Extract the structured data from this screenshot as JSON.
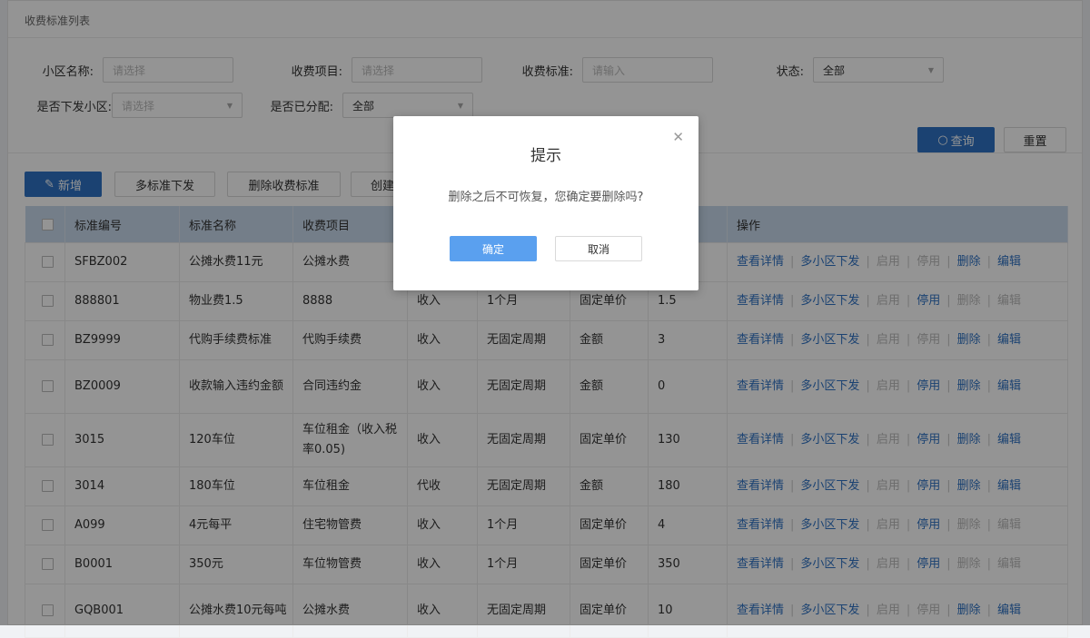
{
  "panel": {
    "title": "收费标准列表"
  },
  "filters": {
    "community": {
      "label": "小区名称:",
      "placeholder": "请选择"
    },
    "charge_item": {
      "label": "收费项目:",
      "placeholder": "请选择"
    },
    "charge_standard": {
      "label": "收费标准:",
      "placeholder": "请输入"
    },
    "status": {
      "label": "状态:",
      "value": "全部"
    },
    "issued_community": {
      "label": "是否下发小区:",
      "placeholder": "请选择"
    },
    "assigned": {
      "label": "是否已分配:",
      "value": "全部"
    },
    "search_label": "查询",
    "reset_label": "重置"
  },
  "toolbar": {
    "add_label": "新增",
    "multi_issue_label": "多标准下发",
    "delete_label": "删除收费标准",
    "create_label": "创建"
  },
  "table": {
    "columns": [
      "标准编号",
      "标准名称",
      "收费项目",
      "",
      "",
      "",
      "",
      "操作"
    ],
    "rows": [
      [
        "SFBZ002",
        "公摊水费11元",
        "公摊水费",
        "",
        "",
        "",
        ""
      ],
      [
        "888801",
        "物业费1.5",
        "8888",
        "收入",
        "1个月",
        "固定单价",
        "1.5"
      ],
      [
        "BZ9999",
        "代购手续费标准",
        "代购手续费",
        "收入",
        "无固定周期",
        "金额",
        "3"
      ],
      [
        "BZ0009",
        "收款输入违约金额",
        "合同违约金",
        "收入",
        "无固定周期",
        "金额",
        "0"
      ],
      [
        "3015",
        "120车位",
        "车位租金（收入税率0.05)",
        "收入",
        "无固定周期",
        "固定单价",
        "130"
      ],
      [
        "3014",
        "180车位",
        "车位租金",
        "代收",
        "无固定周期",
        "金额",
        "180"
      ],
      [
        "A099",
        "4元每平",
        "住宅物管费",
        "收入",
        "1个月",
        "固定单价",
        "4"
      ],
      [
        "B0001",
        "350元",
        "车位物管费",
        "收入",
        "1个月",
        "固定单价",
        "350"
      ],
      [
        "GQB001",
        "公摊水费10元每吨",
        "公摊水费",
        "收入",
        "无固定周期",
        "固定单价",
        "10"
      ]
    ],
    "ops": {
      "detail": "查看详情",
      "multi": "多小区下发",
      "enable": "启用",
      "disable": "停用",
      "delete": "删除",
      "edit": "编辑"
    }
  },
  "dialog": {
    "title": "提示",
    "message": "删除之后不可恢复，您确定要删除吗?",
    "ok_label": "确定",
    "cancel_label": "取消"
  }
}
